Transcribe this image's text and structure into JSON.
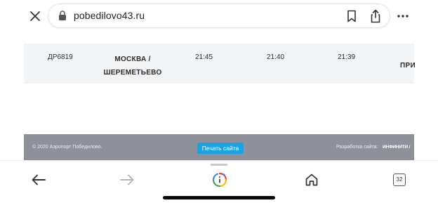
{
  "browser": {
    "url": "pobedilovo43.ru",
    "tab_count": "32",
    "icons": {
      "close": "close-icon",
      "lock": "lock-icon",
      "bookmark": "bookmark-icon",
      "share": "share-icon",
      "more": "more-icon",
      "back": "back-arrow-icon",
      "forward": "forward-arrow-icon",
      "assistant": "assistant-icon",
      "home": "home-icon",
      "tabs": "tabs-icon"
    }
  },
  "flight": {
    "number": "ДР6819",
    "destination_line1": "МОСКВА /",
    "destination_line2": "ШЕРЕМЕТЬЕВО",
    "time_1": "21:45",
    "time_2": "21:40",
    "time_3": "21:39",
    "status": "ПРИ"
  },
  "footer": {
    "copyright": "© 2020 Аэропорт Победилово.",
    "print_label": "Печать сайта",
    "developer_label": "Разработка сайта:",
    "developer_logo": "ИНФИНИТИ /"
  },
  "colors": {
    "row_bg": "#f3f4f6",
    "footer_bg": "#8e9199",
    "print_button": "#1aa3e3"
  }
}
